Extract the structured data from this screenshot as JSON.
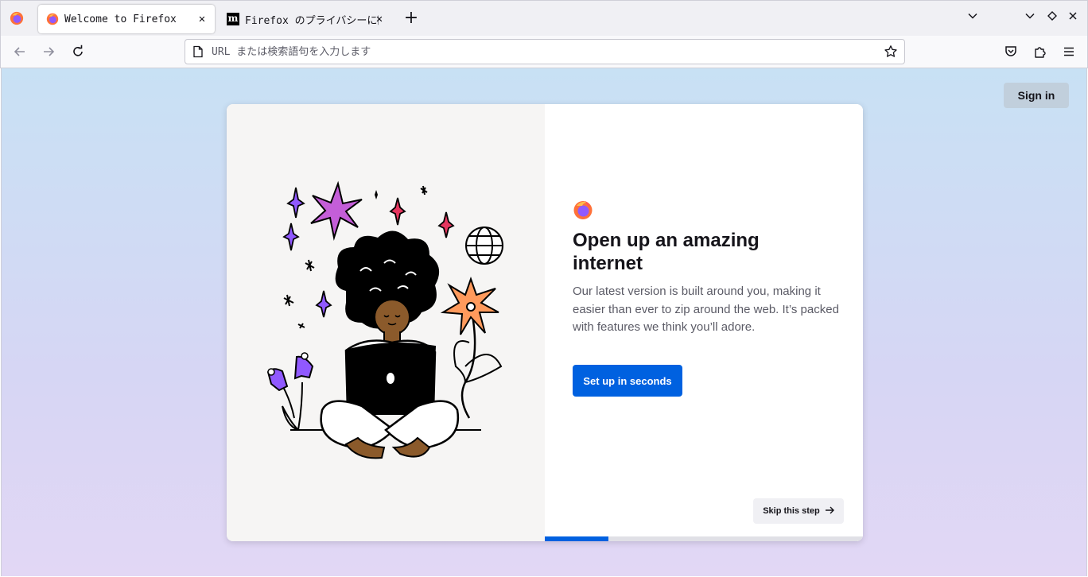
{
  "tabs": [
    {
      "title": "Welcome to Firefox",
      "active": true,
      "favicon": "firefox-icon"
    },
    {
      "title": "Firefox のプライバシーに関する通知",
      "active": false,
      "favicon": "mozilla-m-icon"
    }
  ],
  "urlbar": {
    "placeholder": "URL または検索語句を入力します",
    "value": ""
  },
  "content": {
    "sign_in_label": "Sign in",
    "headline": "Open up an amazing internet",
    "subtext": "Our latest version is built around you, making it easier than ever to zip around the web. It’s packed with features we think you’ll adore.",
    "primary_button": "Set up in seconds",
    "skip_button": "Skip this step",
    "progress_fraction": 0.2
  },
  "colors": {
    "accent": "#0061e0",
    "gradient_top": "#c8e1f4",
    "gradient_bottom": "#e2d7f5"
  }
}
